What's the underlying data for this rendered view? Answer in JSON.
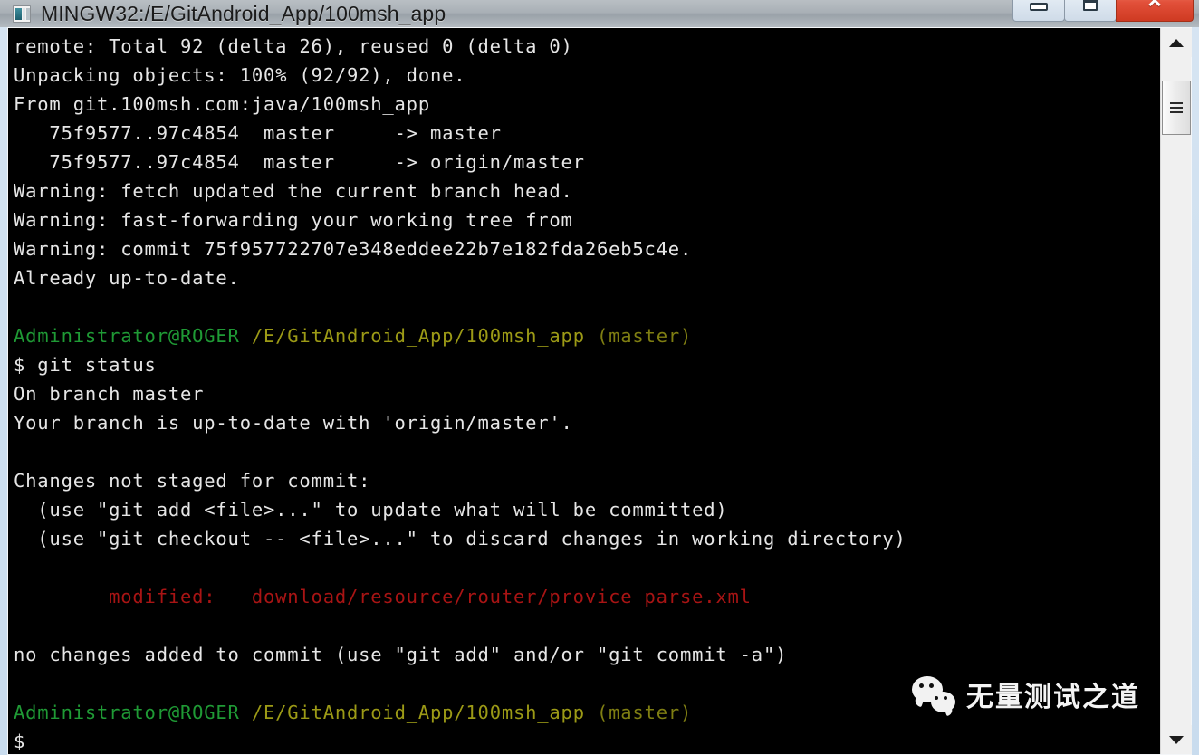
{
  "window": {
    "title": "MINGW32:/E/GitAndroid_App/100msh_app",
    "icon": "terminal-icon",
    "controls": {
      "minimize_label": "–",
      "maximize_label": "□",
      "close_label": "✕"
    }
  },
  "colors": {
    "background": "#000000",
    "foreground": "#e6e6e6",
    "green": "#1f9a35",
    "olive": "#9c9a16",
    "red": "#a81414",
    "titlebar": "#a9b0b6",
    "close_button": "#e2503a"
  },
  "scrollbar": {
    "up_arrow": "chevron-up-icon",
    "down_arrow": "chevron-down-icon",
    "thumb_grip": "grip-icon"
  },
  "terminal": {
    "lines": [
      {
        "id": "l01",
        "segments": [
          {
            "text": "remote: Total 92 (delta 26), reused 0 (delta 0)",
            "color": "white"
          }
        ]
      },
      {
        "id": "l02",
        "segments": [
          {
            "text": "Unpacking objects: 100% (92/92), done.",
            "color": "white"
          }
        ]
      },
      {
        "id": "l03",
        "segments": [
          {
            "text": "From git.100msh.com:java/100msh_app",
            "color": "white"
          }
        ]
      },
      {
        "id": "l04",
        "segments": [
          {
            "text": "   75f9577..97c4854  master     -> master",
            "color": "white"
          }
        ]
      },
      {
        "id": "l05",
        "segments": [
          {
            "text": "   75f9577..97c4854  master     -> origin/master",
            "color": "white"
          }
        ]
      },
      {
        "id": "l06",
        "segments": [
          {
            "text": "Warning: fetch updated the current branch head.",
            "color": "white"
          }
        ]
      },
      {
        "id": "l07",
        "segments": [
          {
            "text": "Warning: fast-forwarding your working tree from",
            "color": "white"
          }
        ]
      },
      {
        "id": "l08",
        "segments": [
          {
            "text": "Warning: commit 75f957722707e348eddee22b7e182fda26eb5c4e.",
            "color": "white"
          }
        ]
      },
      {
        "id": "l09",
        "segments": [
          {
            "text": "Already up-to-date.",
            "color": "white"
          }
        ]
      },
      {
        "id": "l10",
        "segments": [
          {
            "text": "",
            "color": "white"
          }
        ]
      },
      {
        "id": "l11",
        "segments": [
          {
            "text": "Administrator@ROGER",
            "color": "green"
          },
          {
            "text": " ",
            "color": "white"
          },
          {
            "text": "/E/GitAndroid_App/100msh_app",
            "color": "olive"
          },
          {
            "text": " ",
            "color": "white"
          },
          {
            "text": "(master)",
            "color": "olive-dim"
          }
        ]
      },
      {
        "id": "l12",
        "segments": [
          {
            "text": "$ git status",
            "color": "white"
          }
        ]
      },
      {
        "id": "l13",
        "segments": [
          {
            "text": "On branch master",
            "color": "white"
          }
        ]
      },
      {
        "id": "l14",
        "segments": [
          {
            "text": "Your branch is up-to-date with 'origin/master'.",
            "color": "white"
          }
        ]
      },
      {
        "id": "l15",
        "segments": [
          {
            "text": "",
            "color": "white"
          }
        ]
      },
      {
        "id": "l16",
        "segments": [
          {
            "text": "Changes not staged for commit:",
            "color": "white"
          }
        ]
      },
      {
        "id": "l17",
        "segments": [
          {
            "text": "  (use \"git add <file>...\" to update what will be committed)",
            "color": "white"
          }
        ]
      },
      {
        "id": "l18",
        "segments": [
          {
            "text": "  (use \"git checkout -- <file>...\" to discard changes in working directory)",
            "color": "white"
          }
        ]
      },
      {
        "id": "l19",
        "segments": [
          {
            "text": "",
            "color": "white"
          }
        ]
      },
      {
        "id": "l20",
        "segments": [
          {
            "text": "        modified:   download/resource/router/provice_parse.xml",
            "color": "red"
          }
        ]
      },
      {
        "id": "l21",
        "segments": [
          {
            "text": "",
            "color": "white"
          }
        ]
      },
      {
        "id": "l22",
        "segments": [
          {
            "text": "no changes added to commit (use \"git add\" and/or \"git commit -a\")",
            "color": "white"
          }
        ]
      },
      {
        "id": "l23",
        "segments": [
          {
            "text": "",
            "color": "white"
          }
        ]
      },
      {
        "id": "l24",
        "segments": [
          {
            "text": "Administrator@ROGER",
            "color": "green"
          },
          {
            "text": " ",
            "color": "white"
          },
          {
            "text": "/E/GitAndroid_App/100msh_app",
            "color": "olive"
          },
          {
            "text": " ",
            "color": "white"
          },
          {
            "text": "(master)",
            "color": "olive-dim"
          }
        ]
      },
      {
        "id": "l25",
        "segments": [
          {
            "text": "$",
            "color": "white"
          }
        ]
      }
    ]
  },
  "watermark": {
    "logo": "wechat-logo",
    "text": "无量测试之道"
  }
}
